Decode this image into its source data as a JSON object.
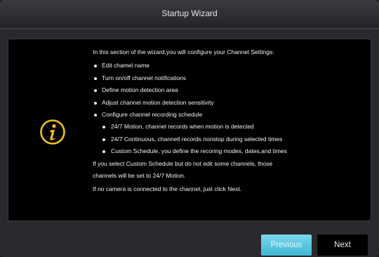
{
  "window": {
    "title": "Startup Wizard"
  },
  "content": {
    "intro": "In this section of the wizard,you will configure your Channel Settings:",
    "bullets": [
      "Edit chamel name",
      "Turn on/off channel notifications",
      "Define motion detection area",
      "Adjust channel motion detection sensitivity",
      "Configure channel recording schedule"
    ],
    "sub_bullets": [
      "24/7 Motion, channel records when motion is detected",
      "24/7 Continuous, channell records nonstop during selected times",
      "Custom Schedule, you define the recoring modes, dates,and times"
    ],
    "note_line1": "If you select Custom Schedule but do not edit some channels, those",
    "note_line2": "channels will be set to 24/7 Motion.",
    "note2": "If no camera is connected to the channel, just click Next.",
    "icon": "info-icon",
    "icon_color": "#f0c020"
  },
  "buttons": {
    "previous": "Previous",
    "next": "Next"
  }
}
